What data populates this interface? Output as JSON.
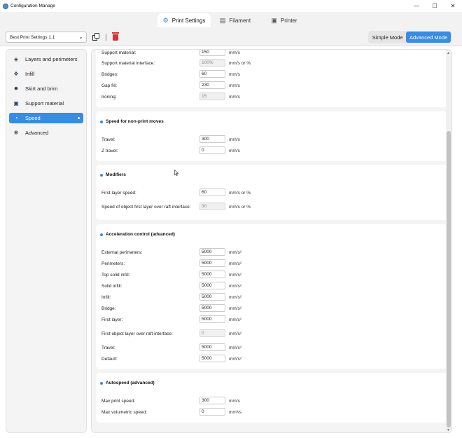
{
  "window": {
    "title": "Configuration Manage"
  },
  "tabs": [
    {
      "label": "Print Settings",
      "icon": "gear-icon"
    },
    {
      "label": "Filament",
      "icon": "filament-spool-icon"
    },
    {
      "label": "Printer",
      "icon": "printer-icon"
    }
  ],
  "toolbar": {
    "preset": "Best Print Settings 1.1",
    "modes": [
      "Simple Mode",
      "Advanced Mode"
    ],
    "active_mode": "Advanced Mode"
  },
  "sidebar": {
    "items": [
      {
        "label": "Layers and perimeters",
        "icon": "layers-icon"
      },
      {
        "label": "Infill",
        "icon": "infill-icon"
      },
      {
        "label": "Skirt and brim",
        "icon": "skirt-brim-icon"
      },
      {
        "label": "Support material",
        "icon": "support-material-icon"
      },
      {
        "label": "Speed",
        "icon": "speed-icon",
        "active": true
      },
      {
        "label": "Advanced",
        "icon": "advanced-icon"
      }
    ]
  },
  "sections": {
    "print_moves": {
      "rows": [
        {
          "label": "Support material:",
          "value": "150",
          "unit": "mm/s"
        },
        {
          "label": "Support material interface:",
          "value": "100%",
          "unit": "mm/s or %",
          "disabled": true
        },
        {
          "label": "Bridges:",
          "value": "60",
          "unit": "mm/s"
        },
        {
          "label": "Gap fill:",
          "value": "230",
          "unit": "mm/s"
        },
        {
          "label": "Ironing:",
          "value": "15",
          "unit": "mm/s",
          "disabled": true
        }
      ]
    },
    "non_print_moves": {
      "title": "Speed for non-print moves",
      "rows": [
        {
          "label": "Travel:",
          "value": "300",
          "unit": "mm/s"
        },
        {
          "label": "Z travel:",
          "value": "0",
          "unit": "mm/s"
        }
      ]
    },
    "modifiers": {
      "title": "Modifiers",
      "rows": [
        {
          "label": "First layer speed:",
          "value": "60",
          "unit": "mm/s or %"
        },
        {
          "label": "Speed of object first layer over raft interface:",
          "value": "30",
          "unit": "mm/s or %",
          "disabled": true
        }
      ]
    },
    "acceleration": {
      "title": "Acceleration control (advanced)",
      "rows": [
        {
          "label": "External perimeters:",
          "value": "5000",
          "unit": "mm/s²"
        },
        {
          "label": "Perimeters:",
          "value": "5000",
          "unit": "mm/s²"
        },
        {
          "label": "Top solid infill:",
          "value": "5000",
          "unit": "mm/s²"
        },
        {
          "label": "Solid infill:",
          "value": "5000",
          "unit": "mm/s²"
        },
        {
          "label": "Infill:",
          "value": "5000",
          "unit": "mm/s²"
        },
        {
          "label": "Bridge:",
          "value": "5000",
          "unit": "mm/s²"
        },
        {
          "label": "First layer:",
          "value": "5000",
          "unit": "mm/s²"
        },
        {
          "label": "First object layer over raft interface:",
          "value": "0",
          "unit": "mm/s²",
          "disabled": true
        },
        {
          "label": "Travel:",
          "value": "5000",
          "unit": "mm/s²"
        },
        {
          "label": "Default:",
          "value": "5000",
          "unit": "mm/s²"
        }
      ]
    },
    "autospeed": {
      "title": "Autospeed (advanced)",
      "rows": [
        {
          "label": "Max print speed:",
          "value": "300",
          "unit": "mm/s"
        },
        {
          "label": "Max volumetric speed:",
          "value": "0",
          "unit": "mm³/s"
        }
      ]
    }
  },
  "colors": {
    "accent": "#3b8be0",
    "danger": "#d63333"
  }
}
